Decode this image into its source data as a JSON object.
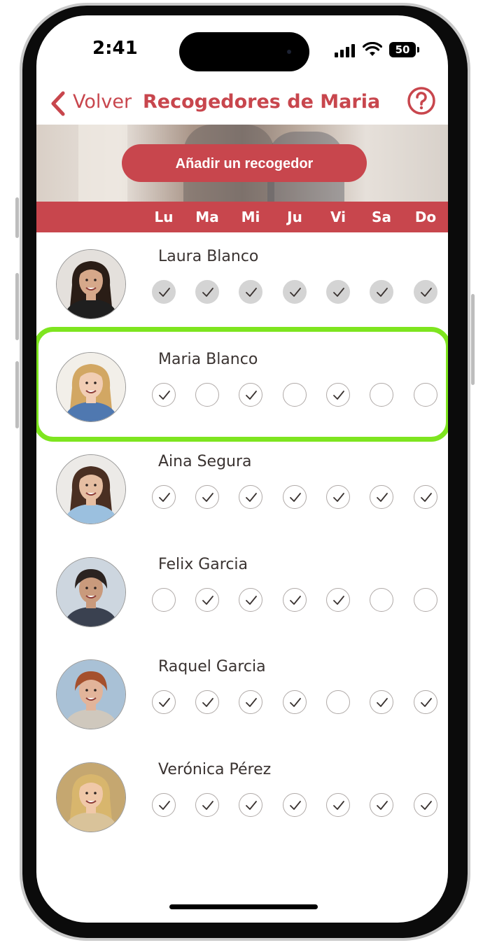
{
  "status_bar": {
    "time": "2:41",
    "battery": "50"
  },
  "header": {
    "back_label": "Volver",
    "title": "Recogedores de Maria",
    "help_icon": "question-circle-icon"
  },
  "banner": {
    "add_button": "Añadir un recogedor"
  },
  "days": [
    "Lu",
    "Ma",
    "Mi",
    "Ju",
    "Vi",
    "Sa",
    "Do"
  ],
  "colors": {
    "accent": "#c8464d",
    "highlight": "#7ee51f",
    "disabled_check": "#d4d4d4"
  },
  "pickers": [
    {
      "name": "Laura Blanco",
      "avatar": "woman-dark-hair-photo",
      "style": "disabled",
      "days": [
        true,
        true,
        true,
        true,
        true,
        true,
        true
      ]
    },
    {
      "name": "Maria Blanco",
      "avatar": "girl-blonde-photo",
      "style": "normal",
      "highlighted": true,
      "days": [
        true,
        false,
        true,
        false,
        true,
        false,
        false
      ]
    },
    {
      "name": "Aina Segura",
      "avatar": "woman-brown-hair-photo",
      "style": "normal",
      "days": [
        true,
        true,
        true,
        true,
        true,
        true,
        true
      ]
    },
    {
      "name": "Felix Garcia",
      "avatar": "man-glasses-beard-photo",
      "style": "normal",
      "days": [
        false,
        true,
        true,
        true,
        true,
        false,
        false
      ]
    },
    {
      "name": "Raquel Garcia",
      "avatar": "woman-short-red-hair-photo",
      "style": "normal",
      "days": [
        true,
        true,
        true,
        true,
        false,
        true,
        true
      ]
    },
    {
      "name": "Verónica Pérez",
      "avatar": "woman-blonde-smiling-photo",
      "style": "normal",
      "days": [
        true,
        true,
        true,
        true,
        true,
        true,
        true
      ]
    }
  ]
}
